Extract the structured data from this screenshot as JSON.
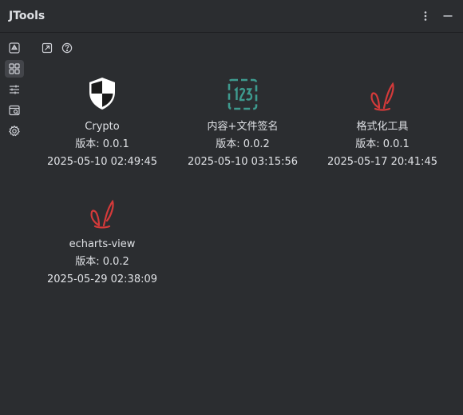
{
  "window": {
    "title": "JTools"
  },
  "title_actions": [
    {
      "icon": "more-vertical-icon"
    },
    {
      "icon": "minimize-icon"
    }
  ],
  "sidebar": {
    "items": [
      {
        "icon": "plugin-store-icon",
        "active": false
      },
      {
        "icon": "apps-grid-icon",
        "active": true
      },
      {
        "icon": "sliders-icon",
        "active": false
      },
      {
        "icon": "calendar-window-icon",
        "active": false
      },
      {
        "icon": "settings-gear-icon",
        "active": false
      }
    ]
  },
  "toolbar": {
    "items": [
      {
        "icon": "external-link-icon"
      },
      {
        "icon": "help-icon"
      }
    ]
  },
  "plugins": [
    {
      "name": "Crypto",
      "version": "版本: 0.0.1",
      "date": "2025-05-10 02:49:45",
      "icon": "shield-icon"
    },
    {
      "name": "内容+文件签名",
      "version": "版本: 0.0.2",
      "date": "2025-05-10 03:15:56",
      "icon": "numbers-123-icon"
    },
    {
      "name": "格式化工具",
      "version": "版本: 0.0.1",
      "date": "2025-05-17 20:41:45",
      "icon": "rabbit-ears-icon"
    },
    {
      "name": "echarts-view",
      "version": "版本: 0.0.2",
      "date": "2025-05-29 02:38:09",
      "icon": "rabbit-ears-icon"
    }
  ],
  "colors": {
    "background": "#2b2d30",
    "text": "#dfe1e5",
    "icon": "#ced0d6",
    "active_bg": "#43454a",
    "teal": "#3e9a8e",
    "rabbit_red": "#d43a3a"
  }
}
